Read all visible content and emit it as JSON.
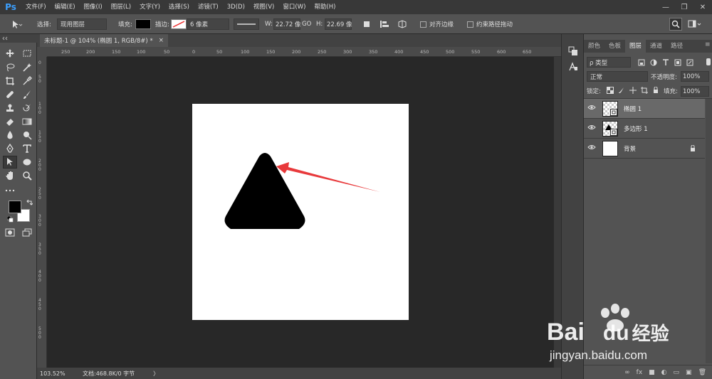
{
  "app": {
    "logo": "Ps"
  },
  "menu": [
    "文件(F)",
    "编辑(E)",
    "图像(I)",
    "图层(L)",
    "文字(Y)",
    "选择(S)",
    "滤镜(T)",
    "3D(D)",
    "视图(V)",
    "窗口(W)",
    "帮助(H)"
  ],
  "window_controls": {
    "minimize": "—",
    "maximize": "❐",
    "close": "✕"
  },
  "options": {
    "select_label": "选择:",
    "select_value": "现用图层",
    "fill_label": "填充:",
    "stroke_label": "描边:",
    "stroke_width": "6 像素",
    "w_label": "W:",
    "w_value": "22.72 像",
    "link_symbol": "GO",
    "h_label": "H:",
    "h_value": "22.69 像",
    "align_edges": "对齐边缘",
    "constrain_path": "约束路径拖动"
  },
  "document_tab": {
    "title": "未标题-1 @ 104% (椭圆 1, RGB/8#) *",
    "close": "×"
  },
  "ruler_h": [
    "250",
    "200",
    "150",
    "100",
    "50",
    "0",
    "50",
    "100",
    "150",
    "200",
    "250",
    "300",
    "350",
    "400",
    "450",
    "500",
    "550",
    "600",
    "650"
  ],
  "ruler_v": [
    "0",
    "50",
    "100",
    "150",
    "200",
    "250",
    "300",
    "350",
    "400",
    "450",
    "500"
  ],
  "status": {
    "zoom": "103.52%",
    "doc": "文档:468.8K/0 字节",
    "arrow": "〉"
  },
  "panel": {
    "tabs": [
      "颜色",
      "色板",
      "图层",
      "通道",
      "路径"
    ],
    "active_tab": "图层",
    "filter_label": "ρ 类型",
    "blend_mode": "正常",
    "opacity_label": "不透明度:",
    "opacity_value": "100%",
    "lock_label": "锁定:",
    "fill_label": "填充:",
    "fill_value": "100%",
    "layers": [
      {
        "name": "椭圆 1",
        "selected": true
      },
      {
        "name": "多边形 1",
        "selected": false
      },
      {
        "name": "背景",
        "selected": false
      }
    ],
    "bottom_icons": [
      "∞",
      "fx",
      "■",
      "◐",
      "▭",
      "▣",
      "🗑"
    ]
  },
  "watermark": {
    "brand": "Bai",
    "brand2": "du",
    "brand_cn": "经验",
    "url": "jingyan.baidu.com"
  },
  "colors": {
    "arrow": "#e8393b",
    "accent": "#3ca0ff"
  }
}
